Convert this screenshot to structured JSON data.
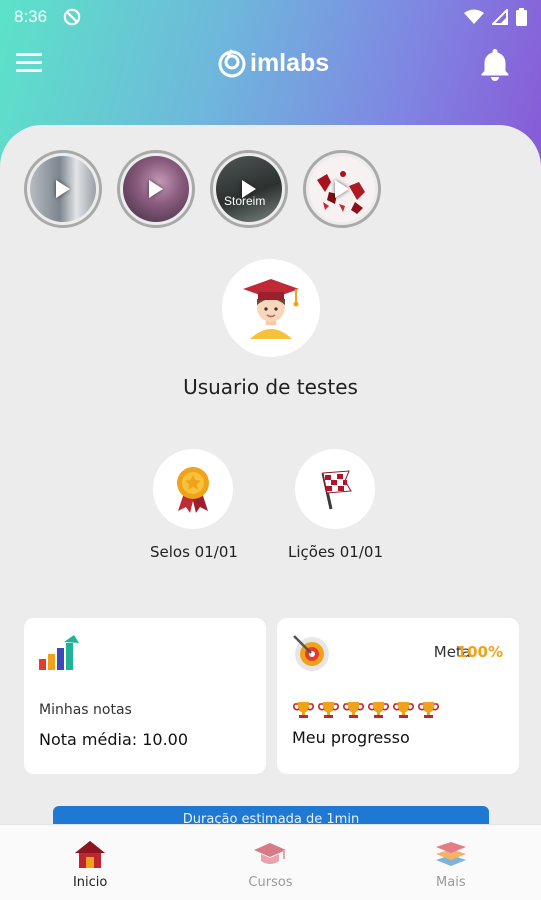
{
  "status_bar": {
    "time": "8:36"
  },
  "app_bar": {
    "brand": "imlabs"
  },
  "stories": [
    {
      "label": ""
    },
    {
      "label": ""
    },
    {
      "label": "Storeim"
    },
    {
      "label": ""
    }
  ],
  "user": {
    "name": "Usuario de testes"
  },
  "achievements": {
    "seals_label": "Selos 01/01",
    "lessons_label": "Lições 01/01"
  },
  "cards": {
    "notes": {
      "label": "Minhas notas",
      "value": "Nota média: 10.00"
    },
    "progress": {
      "meta_label": "Meta",
      "meta_value": "100%",
      "label": "Meu progresso",
      "trophy_count": 6
    }
  },
  "banner": {
    "text": "Duração estimada de 1min"
  },
  "bottom_nav": [
    {
      "label": "Inicio",
      "active": true
    },
    {
      "label": "Cursos",
      "active": false
    },
    {
      "label": "Mais",
      "active": false
    }
  ],
  "colors": {
    "accent_orange": "#f0a21a",
    "banner_blue": "#1f78d1",
    "gradient_start": "#5ce3c8",
    "gradient_end": "#8957d6"
  }
}
